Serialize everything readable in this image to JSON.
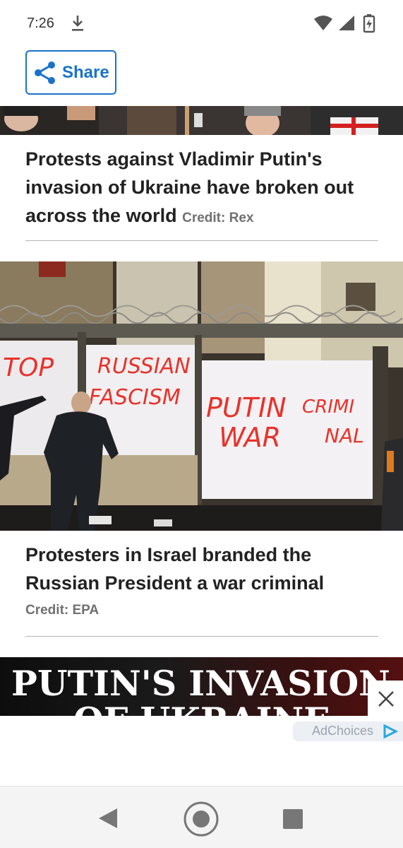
{
  "status_bar": {
    "time": "7:26",
    "icons": [
      "download-icon",
      "wifi-icon",
      "cell-signal-icon",
      "battery-charging-icon"
    ]
  },
  "share": {
    "label": "Share",
    "icon": "share-icon",
    "color": "#1a73c8"
  },
  "gallery": [
    {
      "caption": "Protests against Vladimir Putin's invasion of Ukraine have broken out across the world",
      "credit": "Credit: Rex"
    },
    {
      "image_text": {
        "line1a": "TOP",
        "line1b": "RUSSIAN",
        "line2": "FASCISM",
        "putin": "PUTIN",
        "war": "WAR",
        "crim": "CRIMI",
        "nal": "NAL"
      },
      "caption": "Protesters in Israel branded the Russian President a war criminal",
      "credit": "Credit: EPA"
    }
  ],
  "ad": {
    "banner_line1": "PUTIN'S INVASION",
    "banner_line2": "OF UKRAINE",
    "adchoices_label": "AdChoices",
    "close_icon": "close-icon"
  },
  "nav_bar": {
    "icons": [
      "back-icon",
      "home-icon",
      "recents-icon"
    ]
  }
}
